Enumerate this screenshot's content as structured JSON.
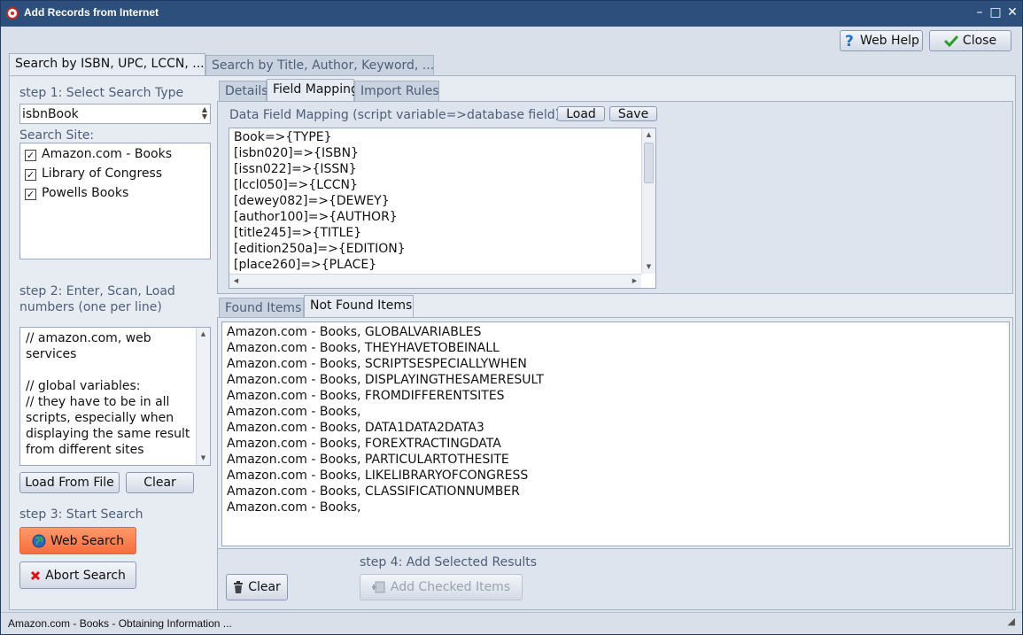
{
  "window": {
    "title": "Add Records from Internet",
    "controls": {
      "minimize": "–",
      "maximize": "□",
      "close": "✕"
    }
  },
  "toolbar": {
    "web_help": "Web Help",
    "close": "Close"
  },
  "main_tabs": [
    {
      "label": "Search by ISBN, UPC, LCCN, ..."
    },
    {
      "label": "Search by Title, Author, Keyword,  ..."
    }
  ],
  "left": {
    "step1": "step 1: Select Search Type",
    "search_type": "isbnBook",
    "search_site_label": "Search Site:",
    "sites": [
      {
        "label": "Amazon.com - Books",
        "checked": true
      },
      {
        "label": "Library of Congress",
        "checked": true
      },
      {
        "label": "Powells Books",
        "checked": true
      }
    ],
    "step2_line1": "step 2: Enter, Scan, Load",
    "step2_line2": "numbers (one per line)",
    "numbers_text": [
      "// amazon.com, web",
      "services",
      "",
      "// global variables:",
      "// they have to be in all",
      "scripts, especially when",
      "displaying the same result",
      "from different sites"
    ],
    "load_from_file": "Load From File",
    "clear": "Clear",
    "step3": "step 3: Start Search",
    "web_search": "Web Search",
    "abort_search": "Abort Search"
  },
  "right": {
    "tabs": [
      {
        "label": "Details"
      },
      {
        "label": "Field Mapping"
      },
      {
        "label": "Import Rules"
      }
    ],
    "mapping_label": "Data Field Mapping (script variable=>database field):",
    "load": "Load",
    "save": "Save",
    "mapping_lines": [
      "Book=>{TYPE}",
      "[isbn020]=>{ISBN}",
      "[issn022]=>{ISSN}",
      "[lccl050]=>{LCCN}",
      "[dewey082]=>{DEWEY}",
      "[author100]=>{AUTHOR}",
      "[title245]=>{TITLE}",
      "[edition250a]=>{EDITION}",
      "[place260]=>{PLACE}"
    ],
    "result_tabs": [
      {
        "label": "Found Items"
      },
      {
        "label": "Not Found Items"
      }
    ],
    "not_found_items": [
      "Amazon.com - Books, GLOBALVARIABLES",
      "Amazon.com - Books, THEYHAVETOBEINALL",
      "Amazon.com - Books, SCRIPTSESPECIALLYWHEN",
      "Amazon.com - Books, DISPLAYINGTHESAMERESULT",
      "Amazon.com - Books, FROMDIFFERENTSITES",
      "Amazon.com - Books,",
      "Amazon.com - Books, DATA1DATA2DATA3",
      "Amazon.com - Books, FOREXTRACTINGDATA",
      "Amazon.com - Books, PARTICULARTOTHESITE",
      "Amazon.com - Books, LIKELIBRARYOFCONGRESS",
      "Amazon.com - Books, CLASSIFICATIONNUMBER",
      "Amazon.com - Books,"
    ],
    "step4": "step 4: Add Selected Results",
    "clear": "Clear",
    "add_checked": "Add Checked Items"
  },
  "status": {
    "text": "Amazon.com - Books - Obtaining Information ..."
  }
}
